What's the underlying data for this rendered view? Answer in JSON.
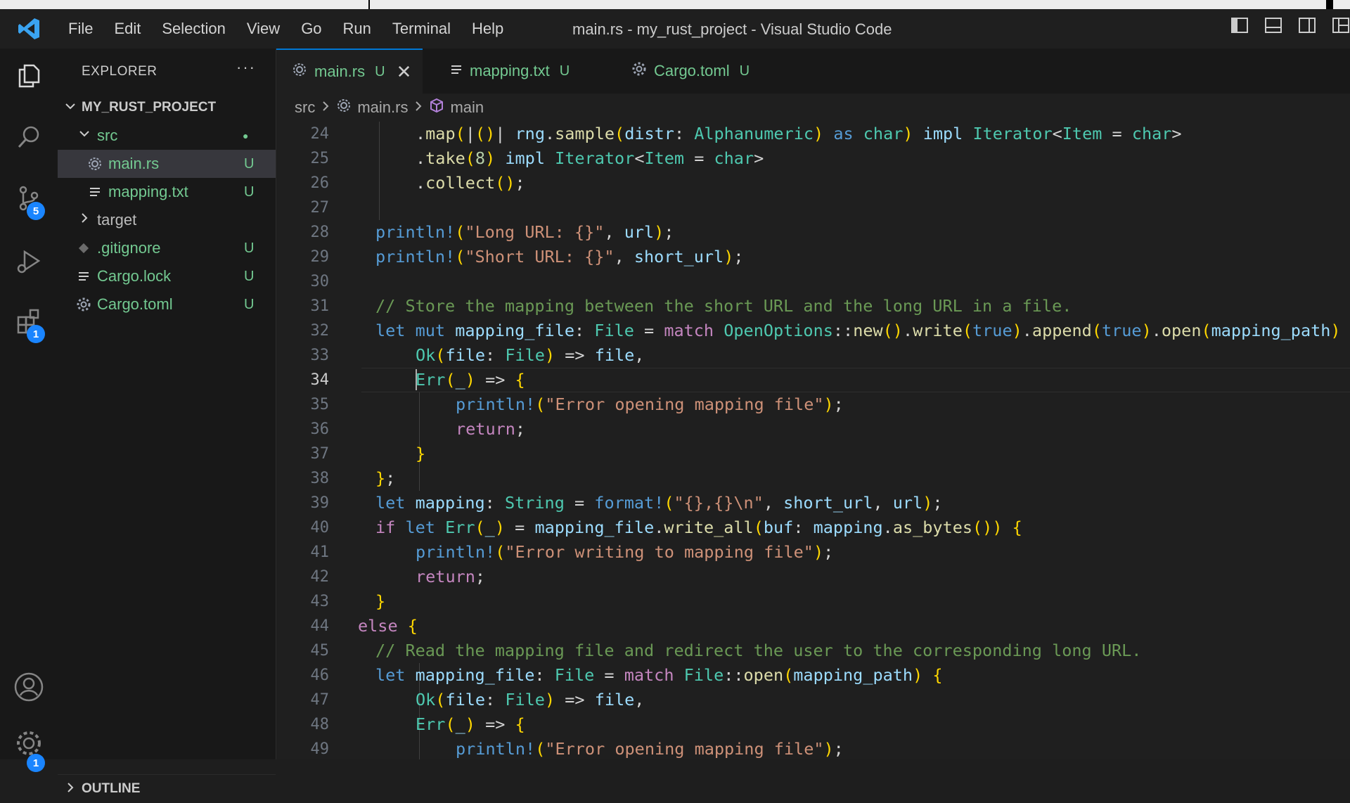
{
  "window": {
    "title": "main.rs - my_rust_project - Visual Studio Code",
    "menu": [
      "File",
      "Edit",
      "Selection",
      "View",
      "Go",
      "Run",
      "Terminal",
      "Help"
    ]
  },
  "activity": {
    "items": [
      {
        "icon": "files-icon"
      },
      {
        "icon": "search-icon"
      },
      {
        "icon": "source-control-icon",
        "badge": "5"
      },
      {
        "icon": "run-debug-icon"
      },
      {
        "icon": "extensions-icon",
        "badge": "1"
      },
      {
        "icon": "account-icon"
      },
      {
        "icon": "settings-gear-icon",
        "badge": "1"
      }
    ]
  },
  "explorer": {
    "title": "EXPLORER",
    "more": "···",
    "project": "MY_RUST_PROJECT",
    "items": [
      {
        "name": "src",
        "status": "●"
      },
      {
        "name": "main.rs",
        "status": "U"
      },
      {
        "name": "mapping.txt",
        "status": "U"
      },
      {
        "name": "target",
        "status": ""
      },
      {
        "name": ".gitignore",
        "status": "U"
      },
      {
        "name": "Cargo.lock",
        "status": "U"
      },
      {
        "name": "Cargo.toml",
        "status": "U"
      }
    ],
    "outline": "OUTLINE"
  },
  "tabs": [
    {
      "label": "main.rs",
      "status": "U",
      "close": "✕"
    },
    {
      "label": "mapping.txt",
      "status": "U"
    },
    {
      "label": "Cargo.toml",
      "status": "U"
    }
  ],
  "breadcrumb": [
    "src",
    "main.rs",
    "main"
  ],
  "editor": {
    "line_numbers": [
      "24",
      "25",
      "26",
      "27",
      "28",
      "29",
      "30",
      "31",
      "32",
      "33",
      "34",
      "35",
      "36",
      "37",
      "38",
      "39",
      "40",
      "41",
      "42",
      "43",
      "44",
      "45",
      "46",
      "47",
      "48",
      "49"
    ],
    "current_line": "34",
    "lines": [
      ".map(|()| rng.sample(distr: Alphanumeric) as char) impl Iterator<Item = char>",
      ".take(8) impl Iterator<Item = char>",
      ".collect();",
      "",
      "println!(\"Long URL: {}\", url);",
      "println!(\"Short URL: {}\", short_url);",
      "",
      "// Store the mapping between the short URL and the long URL in a file.",
      "let mut mapping_file: File = match OpenOptions::new().write(true).append(true).open(mapping_path) {",
      "Ok(file: File) => file,",
      "Err(_) => {",
      "println!(\"Error opening mapping file\");",
      "return;",
      "}",
      "};",
      "let mapping: String = format!(\"{},{}\\n\", short_url, url);",
      "if let Err(_) = mapping_file.write_all(buf: mapping.as_bytes()) {",
      "println!(\"Error writing to mapping file\");",
      "return;",
      "}",
      "else {",
      "// Read the mapping file and redirect the user to the corresponding long URL.",
      "let mapping_file: File = match File::open(mapping_path) {",
      "Ok(file: File) => file,",
      "Err(_) => {",
      "println!(\"Error opening mapping file\");"
    ]
  }
}
